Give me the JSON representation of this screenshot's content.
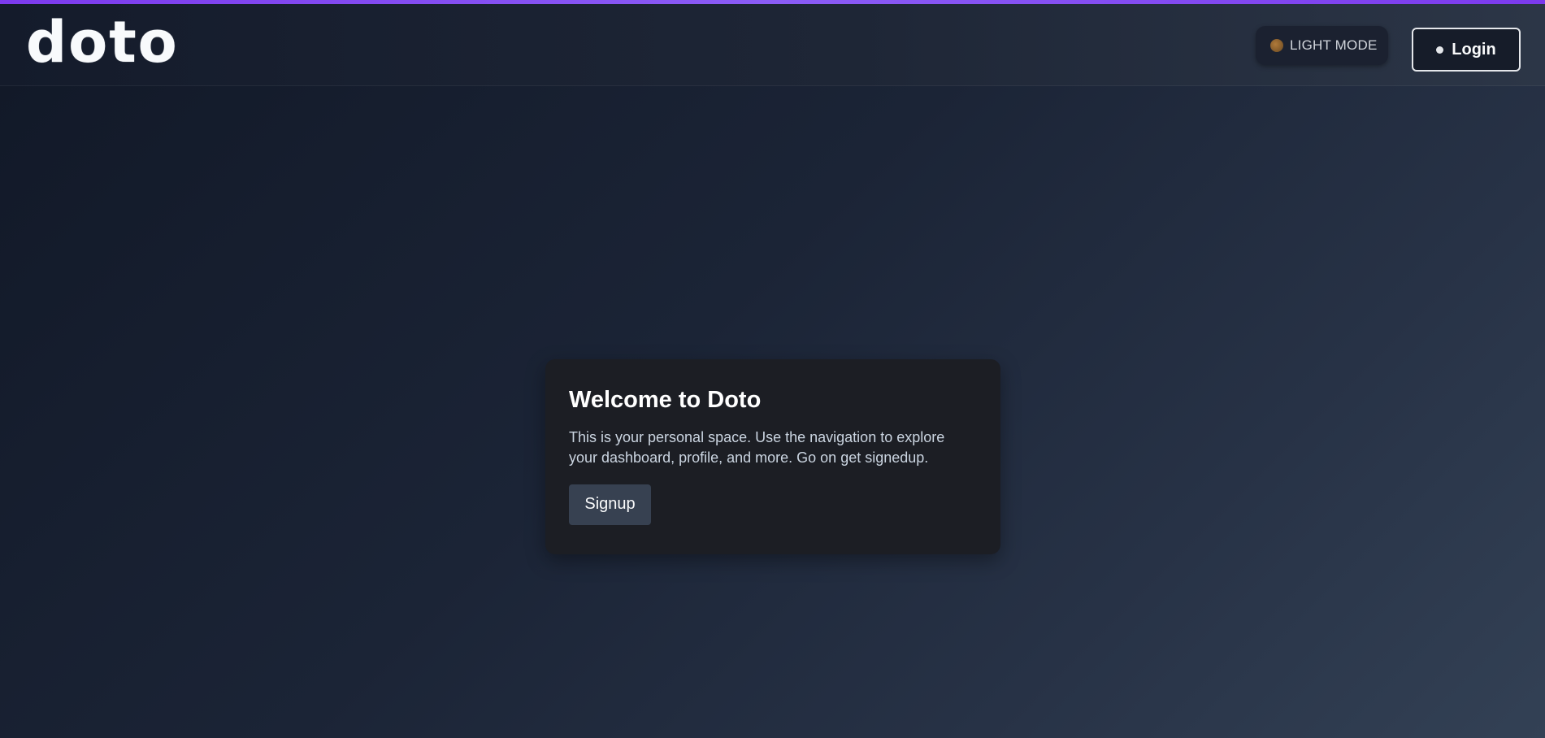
{
  "header": {
    "logo_text": "doto",
    "theme_toggle": {
      "icon": "sun-icon",
      "label": "LIGHT MODE"
    },
    "login": {
      "label": "Login"
    }
  },
  "welcome_card": {
    "title": "Welcome to Doto",
    "description": "This is your personal space. Use the navigation to explore your dashboard, profile, and more. Go on get signedup.",
    "signup_label": "Signup"
  },
  "colors": {
    "accent": "#8b5cf6",
    "background": "#1b2436",
    "card": "#1c1e24",
    "button": "#374151"
  }
}
